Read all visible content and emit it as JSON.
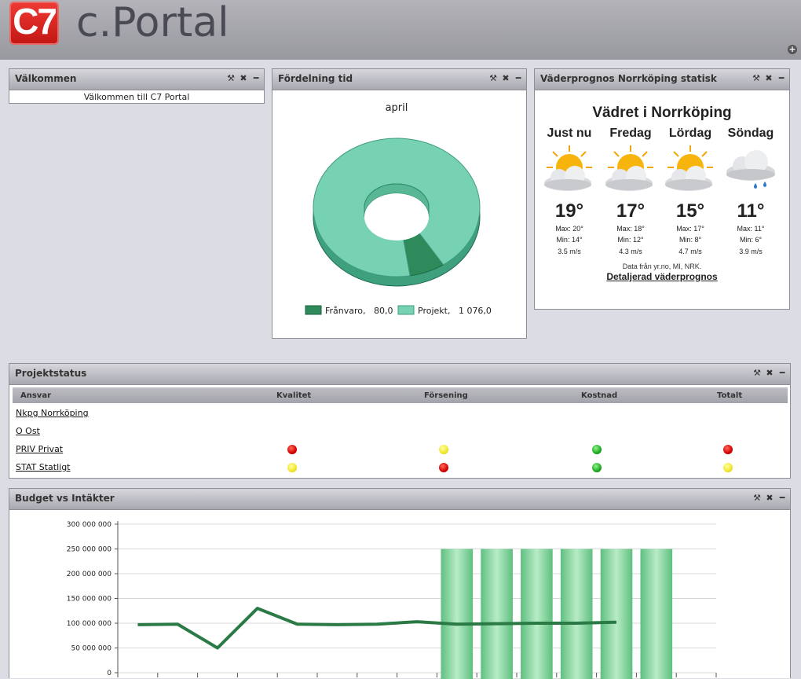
{
  "header": {
    "logo_text": "C7",
    "app_title": "c.Portal",
    "add_icon": "plus-circle-icon"
  },
  "welcome": {
    "title": "Välkommen",
    "text": "Välkommen till C7 Portal"
  },
  "distribution": {
    "title": "Fördelning tid",
    "chart_data": {
      "type": "pie",
      "title": "april",
      "categories": [
        "Frånvaro",
        "Projekt"
      ],
      "values": [
        80.0,
        1076.0
      ],
      "legend": [
        "Frånvaro,   80,0",
        "Projekt,   1 076,0"
      ],
      "colors": [
        "#2f8a5b",
        "#76d2b2"
      ]
    }
  },
  "weather": {
    "title": "Väderprognos Norrköping statisk",
    "heading": "Vädret i Norrköping",
    "days": [
      {
        "day": "Just nu",
        "temp": "19°",
        "max": "Max: 20°",
        "min": "Min: 14°",
        "wind": "3.5 m/s",
        "icon": "sun-cloud-icon"
      },
      {
        "day": "Fredag",
        "temp": "17°",
        "max": "Max: 18°",
        "min": "Min: 12°",
        "wind": "4.3 m/s",
        "icon": "sun-cloud-icon"
      },
      {
        "day": "Lördag",
        "temp": "15°",
        "max": "Max: 17°",
        "min": "Min: 8°",
        "wind": "4.7 m/s",
        "icon": "sun-cloud-icon"
      },
      {
        "day": "Söndag",
        "temp": "11°",
        "max": "Max: 11°",
        "min": "Min: 6°",
        "wind": "3.9 m/s",
        "icon": "rain-cloud-icon"
      }
    ],
    "source": "Data från yr.no, MI, NRK.",
    "link": "Detaljerad väderprognos"
  },
  "projectstatus": {
    "title": "Projektstatus",
    "columns": [
      "Ansvar",
      "Kvalitet",
      "Försening",
      "Kostnad",
      "Totalt"
    ],
    "rows": [
      {
        "name": "Nkpg Norrköping",
        "status": []
      },
      {
        "name": "O Ost",
        "status": []
      },
      {
        "name": "PRIV Privat",
        "status": [
          "red",
          "yellow",
          "green",
          "red"
        ]
      },
      {
        "name": "STAT Statligt",
        "status": [
          "yellow",
          "red",
          "green",
          "yellow"
        ]
      }
    ]
  },
  "budget": {
    "title": "Budget vs Intäkter",
    "chart_data": {
      "type": "bar",
      "y_ticks": [
        "300 000 000",
        "250 000 000",
        "200 000 000",
        "150 000 000",
        "100 000 000",
        "50 000 000",
        "0"
      ],
      "ylim": [
        0,
        300000000
      ],
      "x_count": 15,
      "bar_start_index": 8,
      "bars": [
        250000000,
        250000000,
        250000000,
        250000000,
        250000000,
        250000000
      ],
      "line": [
        97000000,
        98000000,
        50000000,
        130000000,
        98000000,
        97000000,
        98000000,
        103000000,
        98000000,
        99000000,
        100000000,
        100000000,
        102000000
      ],
      "bar_color": "#7fd19a",
      "line_color": "#2a7a46"
    }
  }
}
